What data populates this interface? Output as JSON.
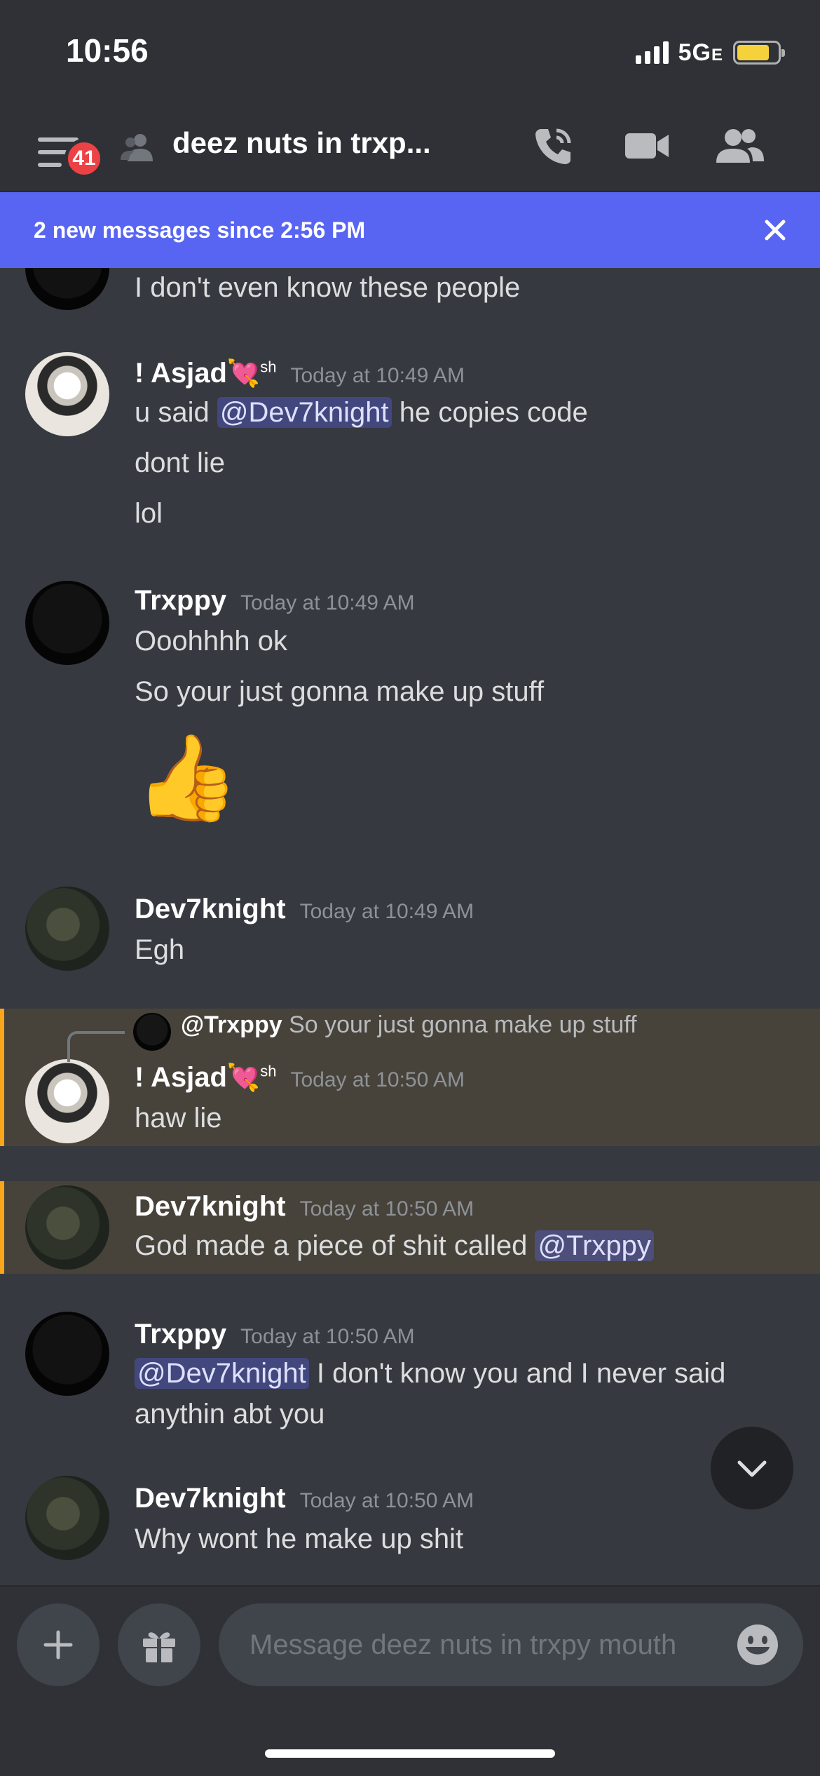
{
  "status_bar": {
    "time": "10:56",
    "network": "5G",
    "network_suffix": "E",
    "battery_level": 0.8
  },
  "header": {
    "unread_badge": "41",
    "channel_title": "deez nuts in trxp...",
    "icons": [
      "menu-icon",
      "group-dm-icon",
      "call-icon",
      "video-icon",
      "members-icon"
    ]
  },
  "new_messages_bar": {
    "text": "2 new messages since 2:56 PM"
  },
  "messages": {
    "m0": {
      "line1": "I don't even know these people"
    },
    "m1": {
      "author": "! Asjad",
      "author_emoji": "💘",
      "author_sup": "sh",
      "timestamp": "Today at 10:49 AM",
      "line1_pre": "u said ",
      "line1_mention": "@Dev7knight",
      "line1_post": " he copies code",
      "line2": "dont lie",
      "line3": "lol"
    },
    "m2": {
      "author": "Trxppy",
      "timestamp": "Today at 10:49 AM",
      "line1": "Ooohhhh ok",
      "line2": "So your just gonna make up stuff",
      "emoji": "👍"
    },
    "m3": {
      "author": "Dev7knight",
      "timestamp": "Today at 10:49 AM",
      "line1": "Egh"
    },
    "m4": {
      "reply_author": "@Trxppy",
      "reply_text": "So your just gonna make up stuff",
      "author": "! Asjad",
      "author_emoji": "💘",
      "author_sup": "sh",
      "timestamp": "Today at 10:50 AM",
      "line1": "haw lie"
    },
    "m5": {
      "author": "Dev7knight",
      "timestamp": "Today at 10:50 AM",
      "line1_pre": "God made a piece of shit called ",
      "line1_mention": "@Trxppy"
    },
    "m6": {
      "author": "Trxppy",
      "timestamp": "Today at 10:50 AM",
      "line1_mention": "@Dev7knight",
      "line1_post": " I don't know you and I never said",
      "line2": "anythin abt you"
    },
    "m7": {
      "author": "Dev7knight",
      "timestamp": "Today at 10:50 AM",
      "line1": "Why wont he make up shit"
    }
  },
  "composer": {
    "placeholder": "Message deez nuts in trxpy mouth"
  },
  "colors": {
    "blurple": "#5865f2",
    "background": "#36393f",
    "highlight": "#47433b",
    "highlight_bar": "#faa61a",
    "badge": "#ed4245"
  }
}
